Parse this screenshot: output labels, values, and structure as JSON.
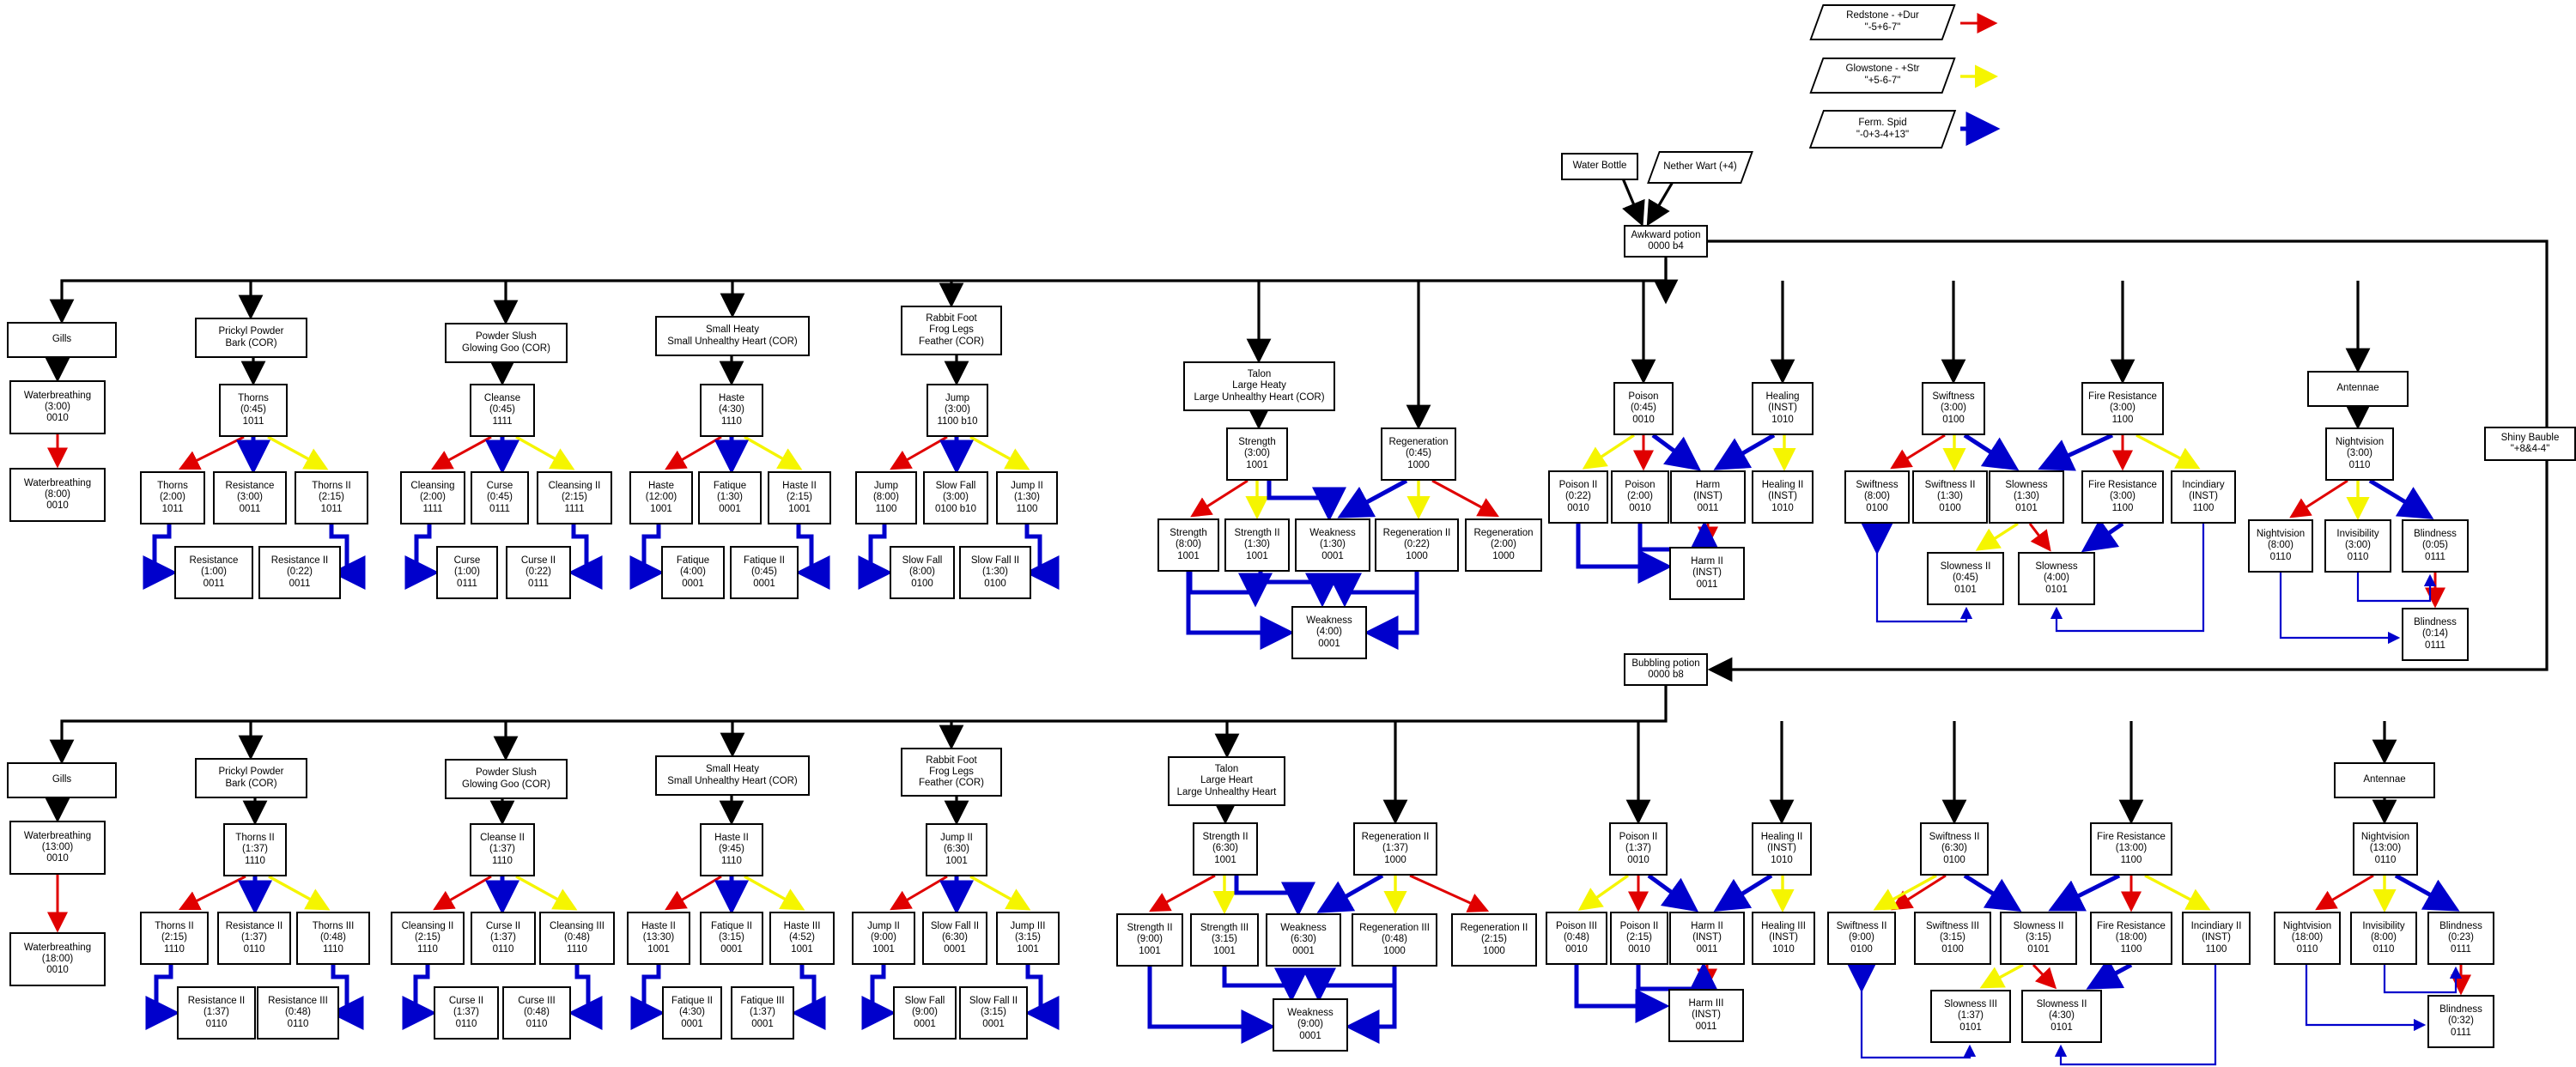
{
  "title": "Potion Brewing Flowchart",
  "legend": {
    "items": [
      {
        "label_line1": "Redstone -  +Dur",
        "label_line2": "\"-5+6-7\"",
        "color": "#e00000",
        "arrow_name": "red-arrow"
      },
      {
        "label_line1": "Glowstone -  +Str",
        "label_line2": "\"+5-6-7\"",
        "color": "#f5f500",
        "arrow_name": "yellow-arrow"
      },
      {
        "label_line1": "Ferm. Spid",
        "label_line2": "\"-0+3-4+13\"",
        "color": "#0000cc",
        "arrow_name": "blue-arrow"
      }
    ]
  },
  "colors": {
    "redstone": "#e00000",
    "glowstone": "#f5f500",
    "fermented": "#0000cc",
    "black": "#000000"
  },
  "base": {
    "water_bottle": "Water Bottle",
    "nether_wart": "Nether Wart\n(+4)",
    "awkward": "Awkward potion\n0000 b4",
    "bubbling": "Bubbling potion\n0000 b8",
    "shiny_bauble": "Shiny Bauble\n\"+8&4-4\""
  },
  "ingredients": {
    "gills": "Gills",
    "prickyl": "Prickyl Powder\nBark (COR)",
    "powder_slush": "Powder Slush\nGlowing Goo (COR)",
    "small_heaty": "Small Heaty\nSmall Unhealthy Heart (COR)",
    "rabbit_foot": "Rabbit Foot\nFrog Legs\nFeather (COR)",
    "talon_top": "Talon\nLarge Heaty\nLarge Unhealthy Heart (COR)",
    "talon_bottom": "Talon\nLarge Heart\nLarge Unhealthy Heart",
    "antennae": "Antennae"
  },
  "chart_data": {
    "type": "diagram",
    "top_tier": {
      "gills": [
        {
          "name": "Waterbreathing",
          "time": "(3:00)",
          "bits": "0010"
        },
        {
          "name": "Waterbreathing",
          "time": "(8:00)",
          "bits": "0010"
        }
      ],
      "prickyl": [
        {
          "name": "Thorns",
          "time": "(0:45)",
          "bits": "1011"
        },
        {
          "name": "Thorns",
          "time": "(2:00)",
          "bits": "1011"
        },
        {
          "name": "Resistance",
          "time": "(3:00)",
          "bits": "0011"
        },
        {
          "name": "Thorns II",
          "time": "(2:15)",
          "bits": "1011"
        },
        {
          "name": "Resistance",
          "time": "(1:00)",
          "bits": "0011"
        },
        {
          "name": "Resistance II",
          "time": "(0:22)",
          "bits": "0011"
        }
      ],
      "powder_slush": [
        {
          "name": "Cleanse",
          "time": "(0:45)",
          "bits": "1111"
        },
        {
          "name": "Cleansing",
          "time": "(2:00)",
          "bits": "1111"
        },
        {
          "name": "Curse",
          "time": "(0:45)",
          "bits": "0111"
        },
        {
          "name": "Cleansing II",
          "time": "(2:15)",
          "bits": "1111"
        },
        {
          "name": "Curse",
          "time": "(1:00)",
          "bits": "0111"
        },
        {
          "name": "Curse II",
          "time": "(0:22)",
          "bits": "0111"
        }
      ],
      "small_heaty": [
        {
          "name": "Haste",
          "time": "(4:30)",
          "bits": "1110"
        },
        {
          "name": "Haste",
          "time": "(12:00)",
          "bits": "1001"
        },
        {
          "name": "Fatique",
          "time": "(1:30)",
          "bits": "0001"
        },
        {
          "name": "Haste II",
          "time": "(2:15)",
          "bits": "1001"
        },
        {
          "name": "Fatique",
          "time": "(4:00)",
          "bits": "0001"
        },
        {
          "name": "Fatique II",
          "time": "(0:45)",
          "bits": "0001"
        }
      ],
      "rabbit_foot": [
        {
          "name": "Jump",
          "time": "(3:00)",
          "bits": "1100 b10"
        },
        {
          "name": "Jump",
          "time": "(8:00)",
          "bits": "1100"
        },
        {
          "name": "Slow Fall",
          "time": "(3:00)",
          "bits": "0100 b10"
        },
        {
          "name": "Jump II",
          "time": "(1:30)",
          "bits": "1100"
        },
        {
          "name": "Slow Fall",
          "time": "(8:00)",
          "bits": "0100"
        },
        {
          "name": "Slow Fall II",
          "time": "(1:30)",
          "bits": "0100"
        }
      ],
      "talon": [
        {
          "name": "Strength",
          "time": "(3:00)",
          "bits": "1001"
        },
        {
          "name": "Strength",
          "time": "(8:00)",
          "bits": "1001"
        },
        {
          "name": "Strength II",
          "time": "(1:30)",
          "bits": "1001"
        },
        {
          "name": "Weakness",
          "time": "(1:30)",
          "bits": "0001"
        },
        {
          "name": "Weakness",
          "time": "(4:00)",
          "bits": "0001"
        }
      ],
      "regeneration": [
        {
          "name": "Regeneration",
          "time": "(0:45)",
          "bits": "1000"
        },
        {
          "name": "Regeneration II",
          "time": "(0:22)",
          "bits": "1000"
        },
        {
          "name": "Regeneration",
          "time": "(2:00)",
          "bits": "1000"
        }
      ],
      "poison": [
        {
          "name": "Poison",
          "time": "(0:45)",
          "bits": "0010"
        },
        {
          "name": "Poison II",
          "time": "(0:22)",
          "bits": "0010"
        },
        {
          "name": "Poison",
          "time": "(2:00)",
          "bits": "0010"
        },
        {
          "name": "Harm",
          "time": "(INST)",
          "bits": "0011"
        },
        {
          "name": "Harm II",
          "time": "(INST)",
          "bits": "0011"
        }
      ],
      "healing": [
        {
          "name": "Healing",
          "time": "(INST)",
          "bits": "1010"
        },
        {
          "name": "Healing II",
          "time": "(INST)",
          "bits": "1010"
        }
      ],
      "swiftness": [
        {
          "name": "Swiftness",
          "time": "(3:00)",
          "bits": "0100"
        },
        {
          "name": "Swiftness",
          "time": "(8:00)",
          "bits": "0100"
        },
        {
          "name": "Swiftness II",
          "time": "(1:30)",
          "bits": "0100"
        },
        {
          "name": "Slowness",
          "time": "(1:30)",
          "bits": "0101"
        },
        {
          "name": "Slowness II",
          "time": "(0:45)",
          "bits": "0101"
        },
        {
          "name": "Slowness",
          "time": "(4:00)",
          "bits": "0101"
        }
      ],
      "fire_resistance": [
        {
          "name": "Fire Resistance",
          "time": "(3:00)",
          "bits": "1100"
        },
        {
          "name": "Fire Resistance",
          "time": "(3:00)",
          "bits": "1100"
        },
        {
          "name": "Incindiary",
          "time": "(INST)",
          "bits": "1100"
        }
      ],
      "antennae": [
        {
          "name": "Nightvision",
          "time": "(3:00)",
          "bits": "0110"
        },
        {
          "name": "Nightvision",
          "time": "(8:00)",
          "bits": "0110"
        },
        {
          "name": "Invisibility",
          "time": "(3:00)",
          "bits": "0110"
        },
        {
          "name": "Blindness",
          "time": "(0:05)",
          "bits": "0111"
        },
        {
          "name": "Blindness",
          "time": "(0:14)",
          "bits": "0111"
        }
      ]
    },
    "bottom_tier": {
      "gills": [
        {
          "name": "Waterbreathing",
          "time": "(13:00)",
          "bits": "0010"
        },
        {
          "name": "Waterbreathing",
          "time": "(18:00)",
          "bits": "0010"
        }
      ],
      "prickyl": [
        {
          "name": "Thorns II",
          "time": "(1:37)",
          "bits": "1110"
        },
        {
          "name": "Thorns II",
          "time": "(2:15)",
          "bits": "1110"
        },
        {
          "name": "Resistance II",
          "time": "(1:37)",
          "bits": "0110"
        },
        {
          "name": "Thorns III",
          "time": "(0:48)",
          "bits": "1110"
        },
        {
          "name": "Resistance II",
          "time": "(1:37)",
          "bits": "0110"
        },
        {
          "name": "Resistance III",
          "time": "(0:48)",
          "bits": "0110"
        }
      ],
      "powder_slush": [
        {
          "name": "Cleanse II",
          "time": "(1:37)",
          "bits": "1110"
        },
        {
          "name": "Cleansing II",
          "time": "(2:15)",
          "bits": "1110"
        },
        {
          "name": "Curse II",
          "time": "(1:37)",
          "bits": "0110"
        },
        {
          "name": "Cleansing III",
          "time": "(0:48)",
          "bits": "1110"
        },
        {
          "name": "Curse II",
          "time": "(1:37)",
          "bits": "0110"
        },
        {
          "name": "Curse III",
          "time": "(0:48)",
          "bits": "0110"
        }
      ],
      "small_heaty": [
        {
          "name": "Haste II",
          "time": "(9:45)",
          "bits": "1110"
        },
        {
          "name": "Haste II",
          "time": "(13:30)",
          "bits": "1001"
        },
        {
          "name": "Fatique II",
          "time": "(3:15)",
          "bits": "0001"
        },
        {
          "name": "Haste III",
          "time": "(4:52)",
          "bits": "1001"
        },
        {
          "name": "Fatique II",
          "time": "(4:30)",
          "bits": "0001"
        },
        {
          "name": "Fatique III",
          "time": "(1:37)",
          "bits": "0001"
        }
      ],
      "rabbit_foot": [
        {
          "name": "Jump II",
          "time": "(6:30)",
          "bits": "1001"
        },
        {
          "name": "Jump II",
          "time": "(9:00)",
          "bits": "1001"
        },
        {
          "name": "Slow Fall II",
          "time": "(6:30)",
          "bits": "0001"
        },
        {
          "name": "Jump III",
          "time": "(3:15)",
          "bits": "1001"
        },
        {
          "name": "Slow Fall",
          "time": "(9:00)",
          "bits": "0001"
        },
        {
          "name": "Slow Fall II",
          "time": "(3:15)",
          "bits": "0001"
        }
      ],
      "talon": [
        {
          "name": "Strength II",
          "time": "(6:30)",
          "bits": "1001"
        },
        {
          "name": "Strength II",
          "time": "(9:00)",
          "bits": "1001"
        },
        {
          "name": "Strength III",
          "time": "(3:15)",
          "bits": "1001"
        },
        {
          "name": "Weakness",
          "time": "(6:30)",
          "bits": "0001"
        },
        {
          "name": "Weakness",
          "time": "(9:00)",
          "bits": "0001"
        }
      ],
      "regeneration": [
        {
          "name": "Regeneration II",
          "time": "(1:37)",
          "bits": "1000"
        },
        {
          "name": "Regeneration III",
          "time": "(0:48)",
          "bits": "1000"
        },
        {
          "name": "Regeneration II",
          "time": "(2:15)",
          "bits": "1000"
        }
      ],
      "poison": [
        {
          "name": "Poison II",
          "time": "(1:37)",
          "bits": "0010"
        },
        {
          "name": "Poison III",
          "time": "(0:48)",
          "bits": "0010"
        },
        {
          "name": "Poison II",
          "time": "(2:15)",
          "bits": "0010"
        },
        {
          "name": "Harm II",
          "time": "(INST)",
          "bits": "0011"
        },
        {
          "name": "Harm III",
          "time": "(INST)",
          "bits": "0011"
        }
      ],
      "healing": [
        {
          "name": "Healing II",
          "time": "(INST)",
          "bits": "1010"
        },
        {
          "name": "Healing III",
          "time": "(INST)",
          "bits": "1010"
        }
      ],
      "swiftness": [
        {
          "name": "Swiftness II",
          "time": "(6:30)",
          "bits": "0100"
        },
        {
          "name": "Swiftness II",
          "time": "(9:00)",
          "bits": "0100"
        },
        {
          "name": "Swiftness III",
          "time": "(3:15)",
          "bits": "0100"
        },
        {
          "name": "Slowness II",
          "time": "(3:15)",
          "bits": "0101"
        },
        {
          "name": "Slowness III",
          "time": "(1:37)",
          "bits": "0101"
        },
        {
          "name": "Slowness II",
          "time": "(4:30)",
          "bits": "0101"
        }
      ],
      "fire_resistance": [
        {
          "name": "Fire Resistance",
          "time": "(13:00)",
          "bits": "1100"
        },
        {
          "name": "Fire Resistance",
          "time": "(18:00)",
          "bits": "1100"
        },
        {
          "name": "Incindiary II",
          "time": "(INST)",
          "bits": "1100"
        }
      ],
      "antennae": [
        {
          "name": "Nightvision",
          "time": "(13:00)",
          "bits": "0110"
        },
        {
          "name": "Nightvision",
          "time": "(18:00)",
          "bits": "0110"
        },
        {
          "name": "Invisibility",
          "time": "(8:00)",
          "bits": "0110"
        },
        {
          "name": "Blindness",
          "time": "(0:23)",
          "bits": "0111"
        },
        {
          "name": "Blindness",
          "time": "(0:32)",
          "bits": "0111"
        }
      ]
    }
  },
  "nodes": {
    "t_gills_1": "Waterbreathing\n(3:00)\n0010",
    "t_gills_2": "Waterbreathing\n(8:00)\n0010",
    "t_pr_0": "Thorns\n(0:45)\n1011",
    "t_pr_1": "Thorns\n(2:00)\n1011",
    "t_pr_2": "Resistance\n(3:00)\n0011",
    "t_pr_3": "Thorns II\n(2:15)\n1011",
    "t_pr_4": "Resistance\n(1:00)\n0011",
    "t_pr_5": "Resistance II\n(0:22)\n0011",
    "t_ps_0": "Cleanse\n(0:45)\n1111",
    "t_ps_1": "Cleansing\n(2:00)\n1111",
    "t_ps_2": "Curse\n(0:45)\n0111",
    "t_ps_3": "Cleansing II\n(2:15)\n1111",
    "t_ps_4": "Curse\n(1:00)\n0111",
    "t_ps_5": "Curse II\n(0:22)\n0111",
    "t_sh_0": "Haste\n(4:30)\n1110",
    "t_sh_1": "Haste\n(12:00)\n1001",
    "t_sh_2": "Fatique\n(1:30)\n0001",
    "t_sh_3": "Haste II\n(2:15)\n1001",
    "t_sh_4": "Fatique\n(4:00)\n0001",
    "t_sh_5": "Fatique II\n(0:45)\n0001",
    "t_rf_0": "Jump\n(3:00)\n1100 b10",
    "t_rf_1": "Jump\n(8:00)\n1100",
    "t_rf_2": "Slow Fall\n(3:00)\n0100 b10",
    "t_rf_3": "Jump II\n(1:30)\n1100",
    "t_rf_4": "Slow Fall\n(8:00)\n0100",
    "t_rf_5": "Slow Fall II\n(1:30)\n0100",
    "t_st_0": "Strength\n(3:00)\n1001",
    "t_st_1": "Strength\n(8:00)\n1001",
    "t_st_2": "Strength II\n(1:30)\n1001",
    "t_wk_1": "Weakness\n(1:30)\n0001",
    "t_wk_2": "Weakness\n(4:00)\n0001",
    "t_rg_0": "Regeneration\n(0:45)\n1000",
    "t_rg_1": "Regeneration II\n(0:22)\n1000",
    "t_rg_2": "Regeneration\n(2:00)\n1000",
    "t_po_0": "Poison\n(0:45)\n0010",
    "t_po_1": "Poison II\n(0:22)\n0010",
    "t_po_2": "Poison\n(2:00)\n0010",
    "t_hm_1": "Harm\n(INST)\n0011",
    "t_hm_2": "Harm II\n(INST)\n0011",
    "t_he_0": "Healing\n(INST)\n1010",
    "t_he_1": "Healing II\n(INST)\n1010",
    "t_sw_0": "Swiftness\n(3:00)\n0100",
    "t_sw_1": "Swiftness\n(8:00)\n0100",
    "t_sw_2": "Swiftness II\n(1:30)\n0100",
    "t_sl_1": "Slowness\n(1:30)\n0101",
    "t_sl_2": "Slowness II\n(0:45)\n0101",
    "t_sl_3": "Slowness\n(4:00)\n0101",
    "t_fr_0": "Fire Resistance\n(3:00)\n1100",
    "t_fr_1": "Fire Resistance\n(3:00)\n1100",
    "t_in_1": "Incindiary\n(INST)\n1100",
    "t_nv_0": "Nightvision\n(3:00)\n0110",
    "t_nv_1": "Nightvision\n(8:00)\n0110",
    "t_iv_1": "Invisibility\n(3:00)\n0110",
    "t_bl_1": "Blindness\n(0:05)\n0111",
    "t_bl_2": "Blindness\n(0:14)\n0111",
    "b_gills_1": "Waterbreathing\n(13:00)\n0010",
    "b_gills_2": "Waterbreathing\n(18:00)\n0010",
    "b_pr_0": "Thorns II\n(1:37)\n1110",
    "b_pr_1": "Thorns II\n(2:15)\n1110",
    "b_pr_2": "Resistance II\n(1:37)\n0110",
    "b_pr_3": "Thorns III\n(0:48)\n1110",
    "b_pr_4": "Resistance II\n(1:37)\n0110",
    "b_pr_5": "Resistance III\n(0:48)\n0110",
    "b_ps_0": "Cleanse II\n(1:37)\n1110",
    "b_ps_1": "Cleansing II\n(2:15)\n1110",
    "b_ps_2": "Curse II\n(1:37)\n0110",
    "b_ps_3": "Cleansing III\n(0:48)\n1110",
    "b_ps_4": "Curse II\n(1:37)\n0110",
    "b_ps_5": "Curse III\n(0:48)\n0110",
    "b_sh_0": "Haste II\n(9:45)\n1110",
    "b_sh_1": "Haste II\n(13:30)\n1001",
    "b_sh_2": "Fatique II\n(3:15)\n0001",
    "b_sh_3": "Haste III\n(4:52)\n1001",
    "b_sh_4": "Fatique II\n(4:30)\n0001",
    "b_sh_5": "Fatique III\n(1:37)\n0001",
    "b_rf_0": "Jump II\n(6:30)\n1001",
    "b_rf_1": "Jump II\n(9:00)\n1001",
    "b_rf_2": "Slow Fall II\n(6:30)\n0001",
    "b_rf_3": "Jump III\n(3:15)\n1001",
    "b_rf_4": "Slow Fall\n(9:00)\n0001",
    "b_rf_5": "Slow Fall II\n(3:15)\n0001",
    "b_st_0": "Strength II\n(6:30)\n1001",
    "b_st_1": "Strength II\n(9:00)\n1001",
    "b_st_2": "Strength III\n(3:15)\n1001",
    "b_wk_1": "Weakness\n(6:30)\n0001",
    "b_wk_2": "Weakness\n(9:00)\n0001",
    "b_rg_0": "Regeneration II\n(1:37)\n1000",
    "b_rg_1": "Regeneration III\n(0:48)\n1000",
    "b_rg_2": "Regeneration II\n(2:15)\n1000",
    "b_po_0": "Poison II\n(1:37)\n0010",
    "b_po_1": "Poison III\n(0:48)\n0010",
    "b_po_2": "Poison II\n(2:15)\n0010",
    "b_hm_1": "Harm II\n(INST)\n0011",
    "b_hm_2": "Harm III\n(INST)\n0011",
    "b_he_0": "Healing II\n(INST)\n1010",
    "b_he_1": "Healing III\n(INST)\n1010",
    "b_sw_0": "Swiftness II\n(6:30)\n0100",
    "b_sw_1": "Swiftness II\n(9:00)\n0100",
    "b_sw_2": "Swiftness III\n(3:15)\n0100",
    "b_sl_1": "Slowness II\n(3:15)\n0101",
    "b_sl_2": "Slowness III\n(1:37)\n0101",
    "b_sl_3": "Slowness II\n(4:30)\n0101",
    "b_fr_0": "Fire Resistance\n(13:00)\n1100",
    "b_fr_1": "Fire Resistance\n(18:00)\n1100",
    "b_in_1": "Incindiary II\n(INST)\n1100",
    "b_nv_0": "Nightvision\n(13:00)\n0110",
    "b_nv_1": "Nightvision\n(18:00)\n0110",
    "b_iv_1": "Invisibility\n(8:00)\n0110",
    "b_bl_1": "Blindness\n(0:23)\n0111",
    "b_bl_2": "Blindness\n(0:32)\n0111"
  }
}
